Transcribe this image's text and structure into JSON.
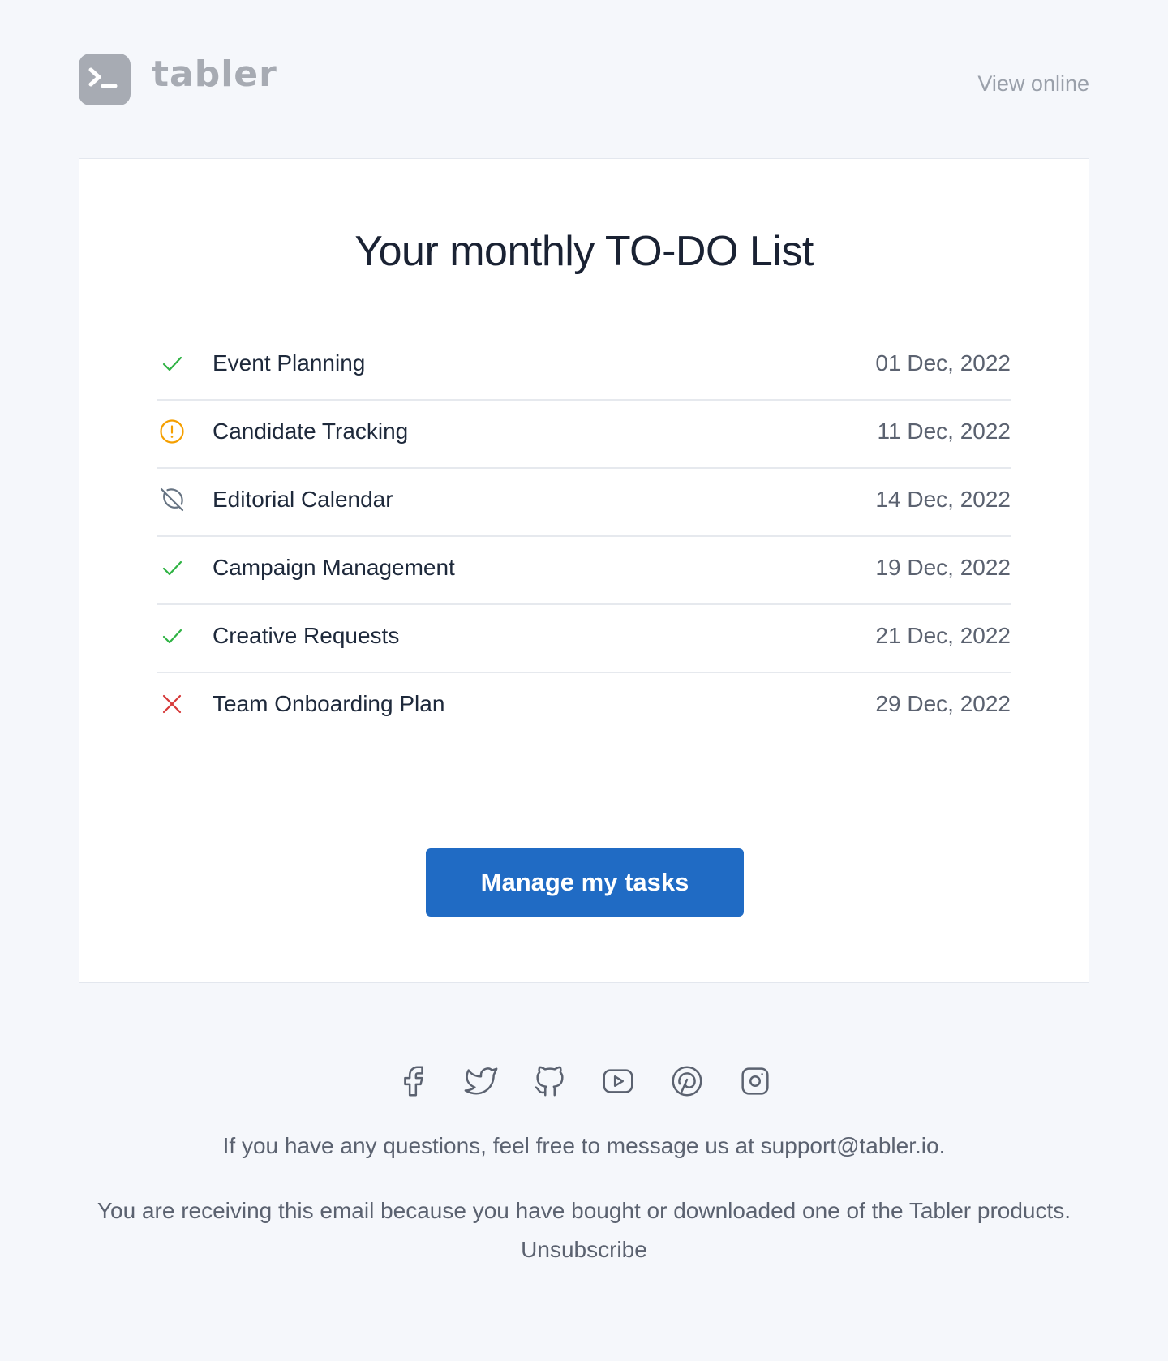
{
  "brand": {
    "name": "tabler",
    "logo_color": "#a7abb3"
  },
  "header": {
    "view_online": "View online"
  },
  "card": {
    "title": "Your monthly TO-DO List",
    "tasks": [
      {
        "name": "Event Planning",
        "date": "01 Dec, 2022",
        "status_icon": "check-icon",
        "status_color": "#2fb344"
      },
      {
        "name": "Candidate Tracking",
        "date": "11 Dec, 2022",
        "status_icon": "alert-circle-icon",
        "status_color": "#f59f00"
      },
      {
        "name": "Editorial Calendar",
        "date": "14 Dec, 2022",
        "status_icon": "circle-off-icon",
        "status_color": "#667382"
      },
      {
        "name": "Campaign Management",
        "date": "19 Dec, 2022",
        "status_icon": "check-icon",
        "status_color": "#2fb344"
      },
      {
        "name": "Creative Requests",
        "date": "21 Dec, 2022",
        "status_icon": "check-icon",
        "status_color": "#2fb344"
      },
      {
        "name": "Team Onboarding Plan",
        "date": "29 Dec, 2022",
        "status_icon": "x-icon",
        "status_color": "#d63939"
      }
    ],
    "button_label": "Manage my tasks",
    "button_color": "#206bc4"
  },
  "footer": {
    "social_icons": [
      "facebook-icon",
      "twitter-icon",
      "github-icon",
      "youtube-icon",
      "pinterest-icon",
      "instagram-icon"
    ],
    "question_text": "If you have any questions, feel free to message us at support@tabler.io.",
    "receiving_text": "You are receiving this email because you have bought or downloaded one of the Tabler products.",
    "unsubscribe": "Unsubscribe"
  }
}
